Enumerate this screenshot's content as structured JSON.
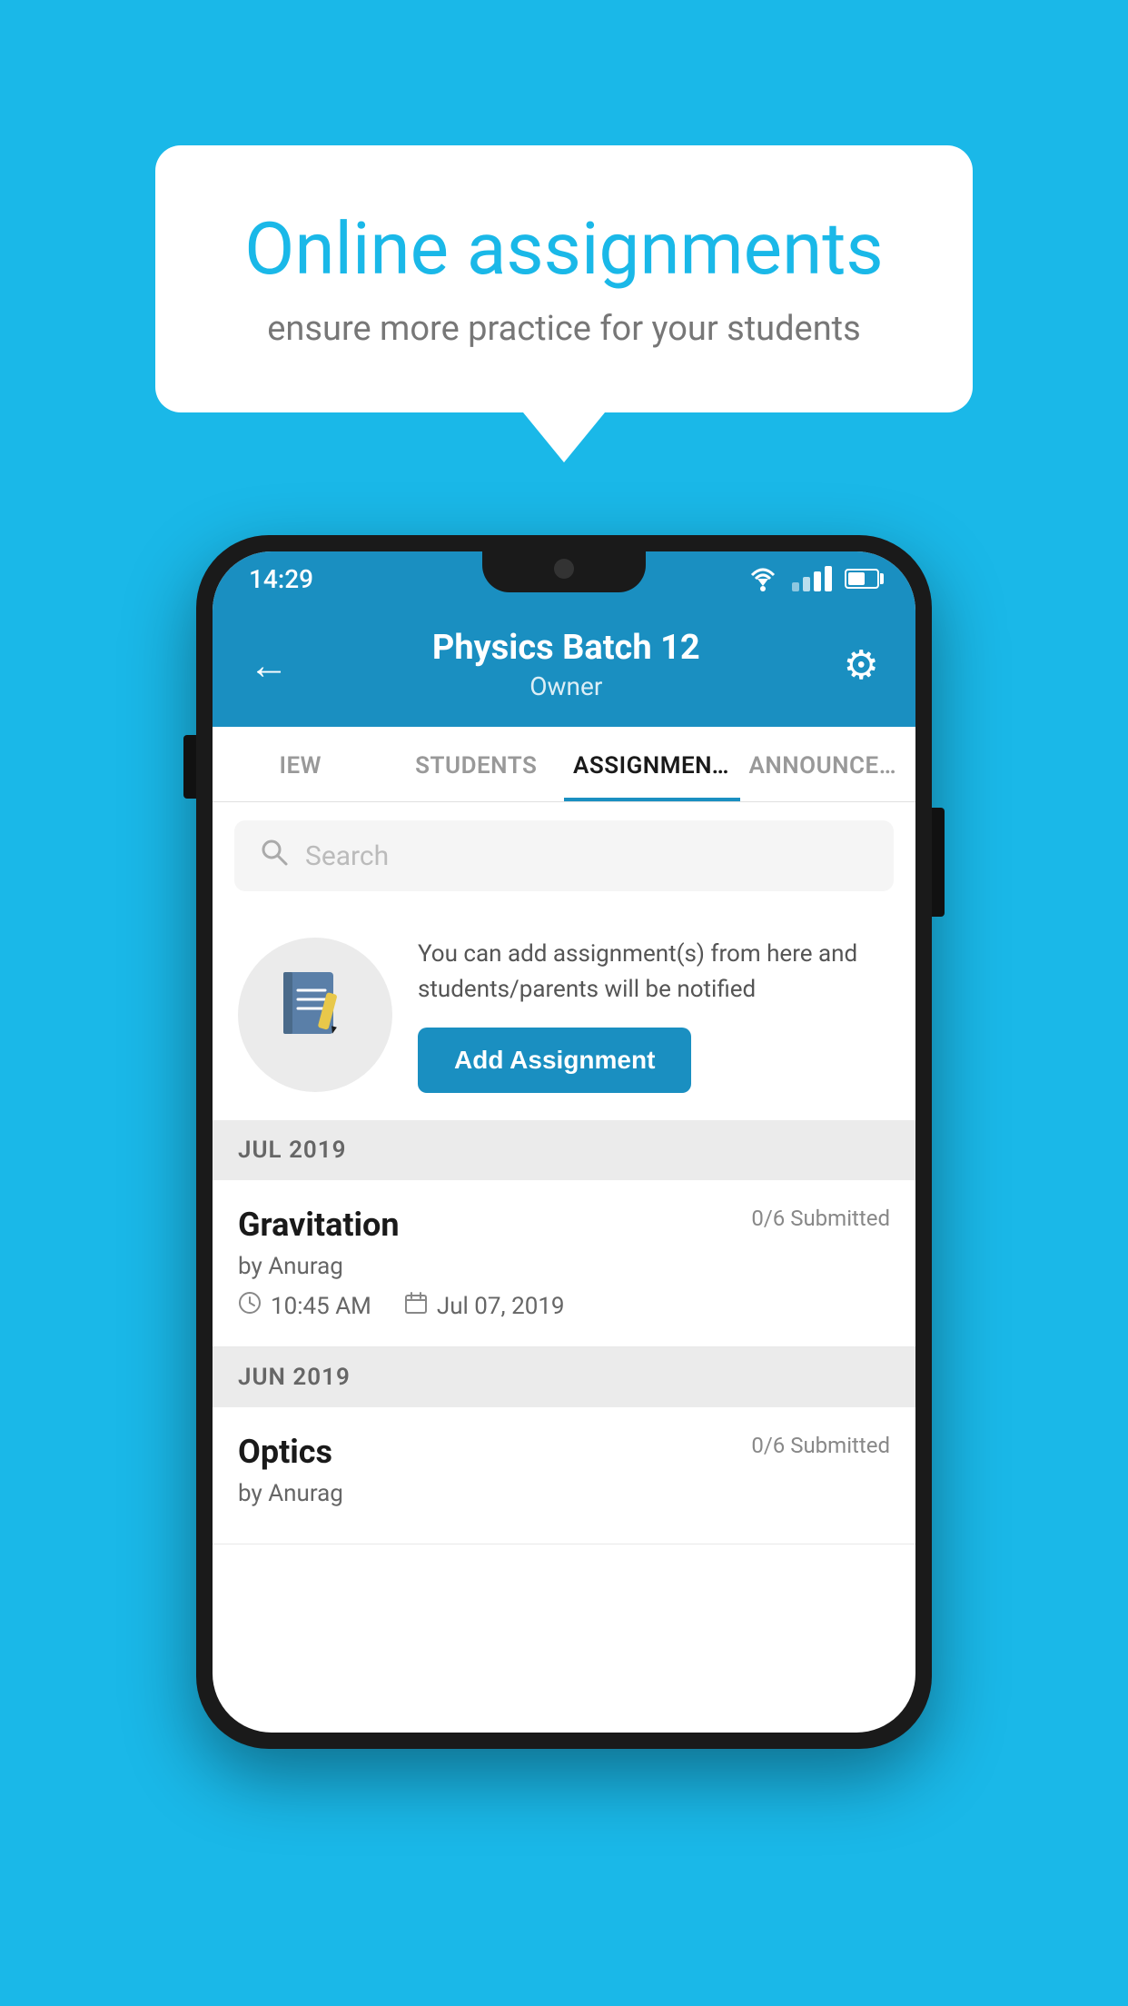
{
  "background_color": "#1ab8e8",
  "speech_bubble": {
    "title": "Online assignments",
    "subtitle": "ensure more practice for your students"
  },
  "status_bar": {
    "time": "14:29"
  },
  "header": {
    "title": "Physics Batch 12",
    "subtitle": "Owner"
  },
  "tabs": [
    {
      "label": "IEW",
      "active": false
    },
    {
      "label": "STUDENTS",
      "active": false
    },
    {
      "label": "ASSIGNMENTS",
      "active": true
    },
    {
      "label": "ANNOUNCEM…",
      "active": false
    }
  ],
  "search": {
    "placeholder": "Search"
  },
  "promo": {
    "text": "You can add assignment(s) from here and students/parents will be notified",
    "button_label": "Add Assignment"
  },
  "sections": [
    {
      "label": "JUL 2019",
      "assignments": [
        {
          "title": "Gravitation",
          "submitted": "0/6 Submitted",
          "author": "by Anurag",
          "time": "10:45 AM",
          "date": "Jul 07, 2019"
        }
      ]
    },
    {
      "label": "JUN 2019",
      "assignments": [
        {
          "title": "Optics",
          "submitted": "0/6 Submitted",
          "author": "by Anurag",
          "time": "",
          "date": ""
        }
      ]
    }
  ]
}
